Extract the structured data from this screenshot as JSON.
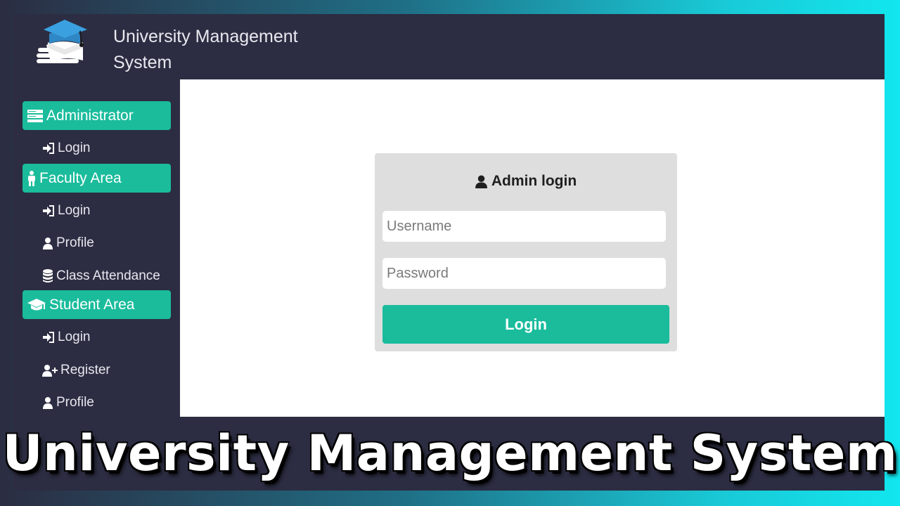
{
  "header": {
    "logo_icon": "graduation-books-icon",
    "title": "University Management System"
  },
  "sidebar": {
    "sections": [
      {
        "label": "Administrator",
        "icon": "server-icon",
        "items": [
          {
            "label": "Login",
            "icon": "sign-in-icon"
          }
        ]
      },
      {
        "label": "Faculty Area",
        "icon": "male-icon",
        "items": [
          {
            "label": "Login",
            "icon": "sign-in-icon"
          },
          {
            "label": "Profile",
            "icon": "user-icon"
          },
          {
            "label": "Class Attendance",
            "icon": "database-icon"
          }
        ]
      },
      {
        "label": "Student Area",
        "icon": "graduation-cap-icon",
        "items": [
          {
            "label": "Login",
            "icon": "sign-in-icon"
          },
          {
            "label": "Register",
            "icon": "user-plus-icon"
          },
          {
            "label": "Profile",
            "icon": "user-icon"
          }
        ]
      }
    ]
  },
  "login": {
    "title": "Admin login",
    "title_icon": "user-icon",
    "username_placeholder": "Username",
    "password_placeholder": "Password",
    "button_label": "Login"
  },
  "banner": {
    "text": "University Management System"
  },
  "colors": {
    "accent": "#1abc9c",
    "frame": "#2c2d42",
    "card": "#dedede"
  }
}
